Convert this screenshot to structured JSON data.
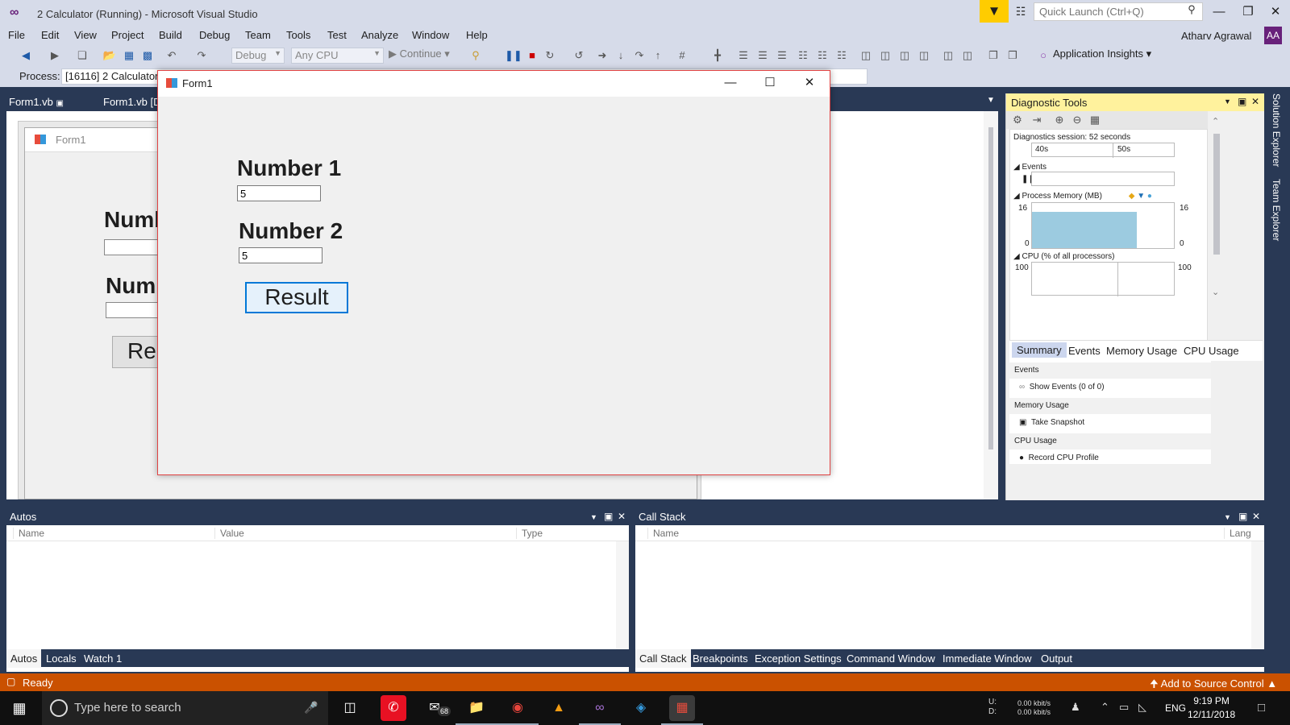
{
  "window": {
    "title": "2 Calculator (Running) - Microsoft Visual Studio",
    "quick_launch_placeholder": "Quick Launch (Ctrl+Q)",
    "user_name": "Atharv Agrawal",
    "user_initials": "AA"
  },
  "menu": {
    "items": [
      "File",
      "Edit",
      "View",
      "Project",
      "Build",
      "Debug",
      "Team",
      "Tools",
      "Test",
      "Analyze",
      "Window",
      "Help"
    ]
  },
  "toolbar": {
    "config": "Debug",
    "platform": "Any CPU",
    "continue_label": "Continue",
    "app_insights_label": "Application Insights",
    "process_label": "Process:",
    "process_value": "[16116] 2 Calculator.e"
  },
  "doc_tabs": [
    "Form1.vb",
    "Form1.vb [D"
  ],
  "designer": {
    "form_title": "Form1",
    "label1": "Numb",
    "label2": "Num",
    "button": "Re"
  },
  "running_form": {
    "title": "Form1",
    "label_number1": "Number 1",
    "input_number1": "5",
    "label_number2": "Number 2",
    "input_number2": "5",
    "result_button": "Result"
  },
  "diagnostic_tools": {
    "title": "Diagnostic Tools",
    "session": "Diagnostics session: 52 seconds",
    "timeline_ticks": [
      "40s",
      "50s"
    ],
    "events_label": "Events",
    "memory_label": "Process Memory (MB)",
    "memory_max": "16",
    "memory_min": "0",
    "memory_fill_fraction": 0.8,
    "cpu_label": "CPU (% of all processors)",
    "cpu_max": "100",
    "tabs": [
      "Summary",
      "Events",
      "Memory Usage",
      "CPU Usage"
    ],
    "summary": {
      "events_head": "Events",
      "show_events": "Show Events (0 of 0)",
      "memory_head": "Memory Usage",
      "take_snapshot": "Take Snapshot",
      "cpu_head": "CPU Usage",
      "record_cpu": "Record CPU Profile"
    }
  },
  "side_tabs": [
    "Solution Explorer",
    "Team Explorer"
  ],
  "autos_panel": {
    "title": "Autos",
    "columns": [
      "Name",
      "Value",
      "Type"
    ],
    "tabs": [
      "Autos",
      "Locals",
      "Watch 1"
    ]
  },
  "callstack_panel": {
    "title": "Call Stack",
    "columns": [
      "Name",
      "Lang"
    ],
    "tabs": [
      "Call Stack",
      "Breakpoints",
      "Exception Settings",
      "Command Window",
      "Immediate Window",
      "Output"
    ]
  },
  "status_bar": {
    "text": "Ready",
    "source_control": "Add to Source Control"
  },
  "taskbar": {
    "search_placeholder": "Type here to search",
    "mail_badge": "68",
    "net_labels": "U:\nD:",
    "net_up": "0.00 kbit/s",
    "net_down": "0.00 kbit/s",
    "language": "ENG",
    "time": "9:19 PM",
    "date": "12/11/2018"
  },
  "colors": {
    "accent": "#68217a",
    "status_bar": "#ca5100",
    "panel_header": "#293955",
    "diag_header": "#fff29d"
  }
}
